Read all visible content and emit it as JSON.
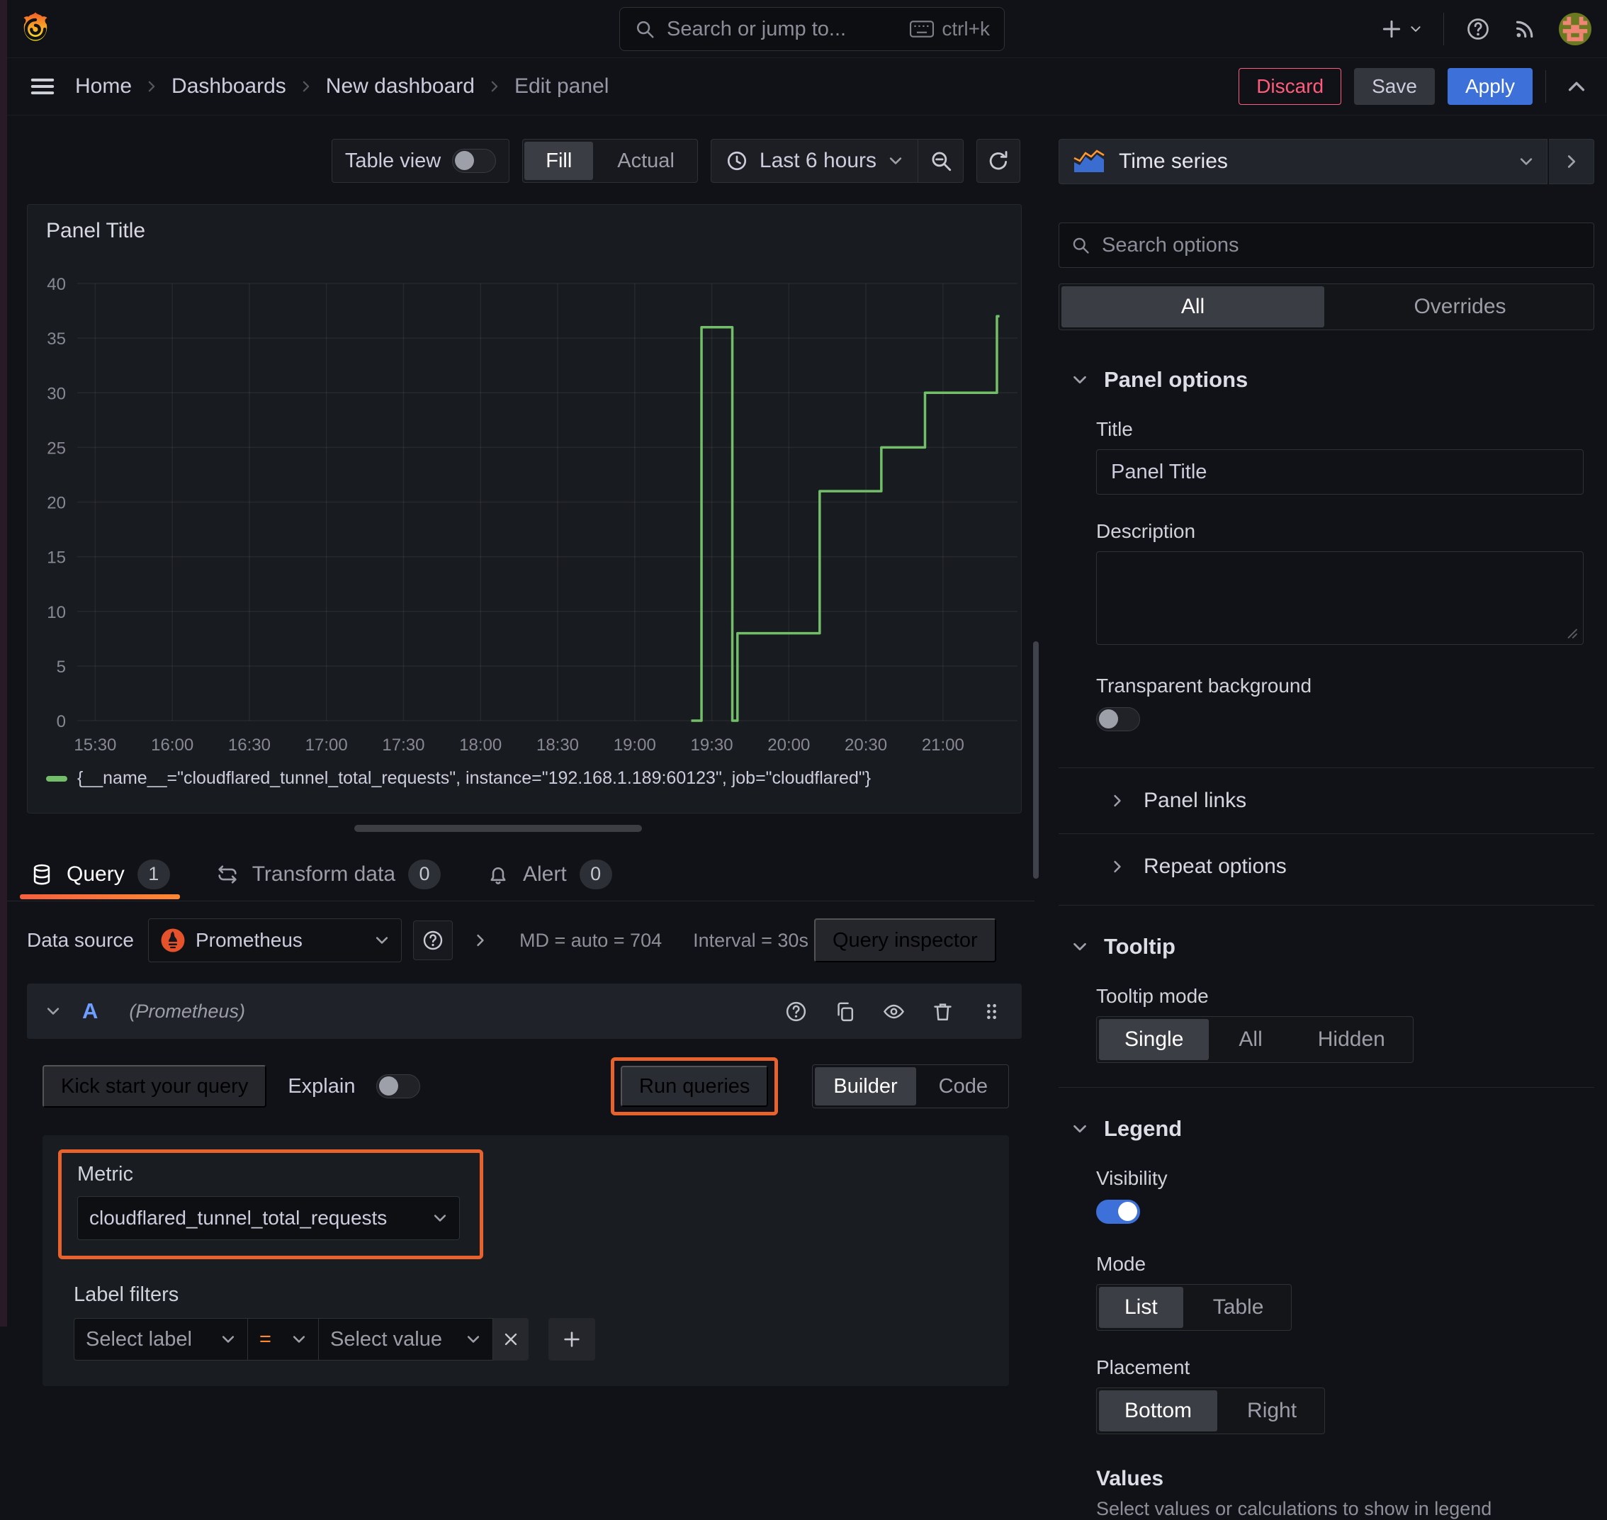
{
  "topbar": {
    "search_placeholder": "Search or jump to...",
    "search_shortcut": "ctrl+k"
  },
  "breadcrumb": {
    "items": [
      "Home",
      "Dashboards",
      "New dashboard",
      "Edit panel"
    ],
    "discard": "Discard",
    "save": "Save",
    "apply": "Apply"
  },
  "toolbar": {
    "table_view": "Table view",
    "fill": "Fill",
    "actual": "Actual",
    "time_range": "Last 6 hours"
  },
  "panel": {
    "title": "Panel Title"
  },
  "chart_data": {
    "type": "line",
    "title": "Panel Title",
    "x_domain": [
      "15:23",
      "21:29"
    ],
    "x_ticks": [
      "15:30",
      "16:00",
      "16:30",
      "17:00",
      "17:30",
      "18:00",
      "18:30",
      "19:00",
      "19:30",
      "20:00",
      "20:30",
      "21:00"
    ],
    "ylim": [
      0,
      40
    ],
    "y_ticks": [
      0,
      5,
      10,
      15,
      20,
      25,
      30,
      35,
      40
    ],
    "grid": true,
    "legend_position": "bottom",
    "series": [
      {
        "name": "{__name__=\"cloudflared_tunnel_total_requests\", instance=\"192.168.1.189:60123\", job=\"cloudflared\"}",
        "color": "#73bf69",
        "step_mode": "step-after",
        "steps": [
          [
            "19:22",
            0
          ],
          [
            "19:26",
            36
          ],
          [
            "19:38",
            0
          ],
          [
            "19:40",
            8
          ],
          [
            "20:12",
            21
          ],
          [
            "20:36",
            25
          ],
          [
            "20:53",
            30
          ],
          [
            "21:21",
            37
          ]
        ],
        "end": "21:22"
      }
    ]
  },
  "tabs": {
    "query": {
      "label": "Query",
      "count": "1"
    },
    "transform": {
      "label": "Transform data",
      "count": "0"
    },
    "alert": {
      "label": "Alert",
      "count": "0"
    }
  },
  "datasource_row": {
    "label": "Data source",
    "value": "Prometheus",
    "md": "MD = auto = 704",
    "interval": "Interval = 30s",
    "inspector": "Query inspector"
  },
  "query_editor": {
    "ref": "A",
    "ds_hint": "(Prometheus)",
    "kick_start": "Kick start your query",
    "explain": "Explain",
    "run_queries": "Run queries",
    "builder": "Builder",
    "code": "Code",
    "metric_label": "Metric",
    "metric_value": "cloudflared_tunnel_total_requests",
    "label_filters": "Label filters",
    "select_label": "Select label",
    "operator": "=",
    "select_value": "Select value"
  },
  "options": {
    "viz": "Time series",
    "search_placeholder": "Search options",
    "tab_all": "All",
    "tab_overrides": "Overrides",
    "panel_options": {
      "heading": "Panel options",
      "title_label": "Title",
      "title_value": "Panel Title",
      "description_label": "Description",
      "transparent_label": "Transparent background"
    },
    "links": "Panel links",
    "repeat": "Repeat options",
    "tooltip": {
      "heading": "Tooltip",
      "mode_label": "Tooltip mode",
      "modes": [
        "Single",
        "All",
        "Hidden"
      ]
    },
    "legend": {
      "heading": "Legend",
      "visibility_label": "Visibility",
      "mode_label": "Mode",
      "modes": [
        "List",
        "Table"
      ],
      "placement_label": "Placement",
      "placements": [
        "Bottom",
        "Right"
      ],
      "values_label": "Values",
      "values_hint": "Select values or calculations to show in legend"
    }
  },
  "colors": {
    "accent_blue": "#3d71d9",
    "series_green": "#73bf69",
    "annotation_orange": "#e8622d",
    "discard_pink": "#ff5c7c",
    "tab_underline_start": "#f55f3e",
    "tab_underline_end": "#ff8833"
  }
}
